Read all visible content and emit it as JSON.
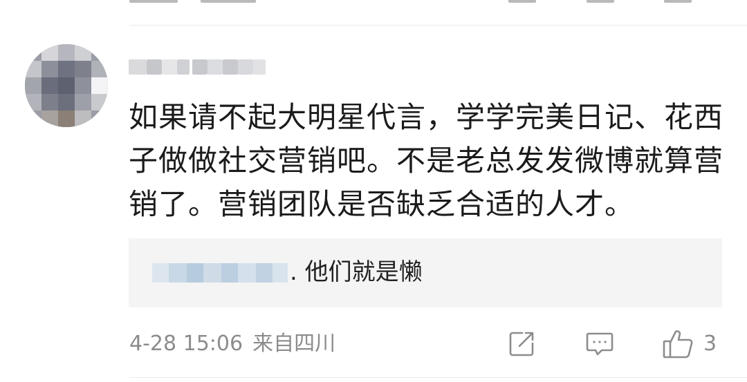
{
  "comment": {
    "text": "如果请不起大明星代言，学学完美日记、花西子做做社交营销吧。不是老总发发微博就算营销了。营销团队是否缺乏合适的人才。",
    "reply": {
      "text": ". 他们就是懒"
    },
    "date": "4-28 15:06",
    "location": "来自四川",
    "like_count": "3"
  },
  "icons": {
    "share": "share-edit-icon",
    "comment": "comment-bubble-icon",
    "like": "thumbs-up-icon"
  },
  "colors": {
    "text": "#1b1b1b",
    "meta": "#8c8c8c",
    "reply_bg": "#f4f4f4",
    "divider": "#ececec"
  }
}
